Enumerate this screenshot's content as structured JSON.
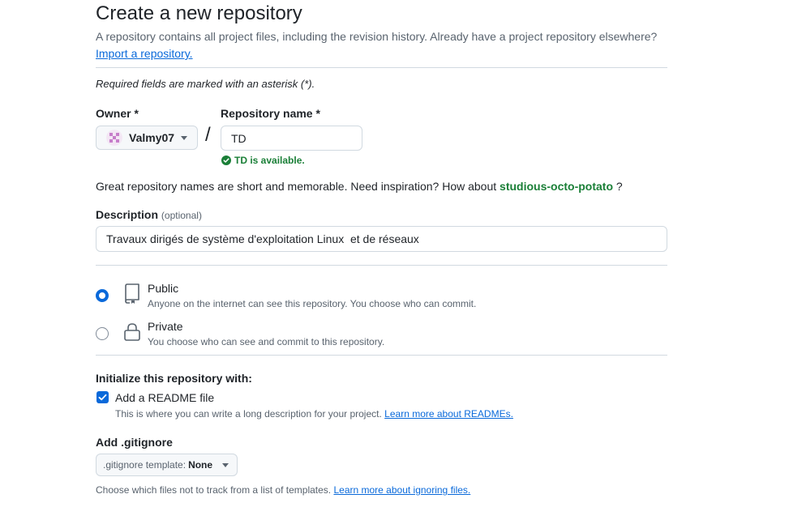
{
  "page": {
    "title": "Create a new repository",
    "subtitle": "A repository contains all project files, including the revision history. Already have a project repository elsewhere?",
    "import_link": "Import a repository.",
    "required_note": "Required fields are marked with an asterisk (*)."
  },
  "owner": {
    "label": "Owner *",
    "value": "Valmy07"
  },
  "repo_name": {
    "label": "Repository name *",
    "value": "TD",
    "availability": "TD is available."
  },
  "inspiration": {
    "text": "Great repository names are short and memorable. Need inspiration? How about",
    "suggestion": "studious-octo-potato",
    "suffix": "?"
  },
  "description": {
    "label": "Description",
    "optional": "(optional)",
    "value": "Travaux dirigés de système d'exploitation Linux  et de réseaux"
  },
  "visibility": {
    "selected": "public",
    "options": [
      {
        "title": "Public",
        "desc": "Anyone on the internet can see this repository. You choose who can commit.",
        "icon": "repo-icon"
      },
      {
        "title": "Private",
        "desc": "You choose who can see and commit to this repository.",
        "icon": "lock-icon"
      }
    ]
  },
  "init": {
    "heading": "Initialize this repository with:",
    "readme_label": "Add a README file",
    "readme_checked": true,
    "readme_desc": "This is where you can write a long description for your project.",
    "readme_link": "Learn more about READMEs."
  },
  "gitignore": {
    "heading": "Add .gitignore",
    "button_prefix": ".gitignore template:",
    "button_value": "None",
    "note": "Choose which files not to track from a list of templates.",
    "note_link": "Learn more about ignoring files."
  },
  "colors": {
    "accent": "#0969da",
    "success": "#1a7f37",
    "muted": "#59636e",
    "border": "#d1d9e0"
  }
}
